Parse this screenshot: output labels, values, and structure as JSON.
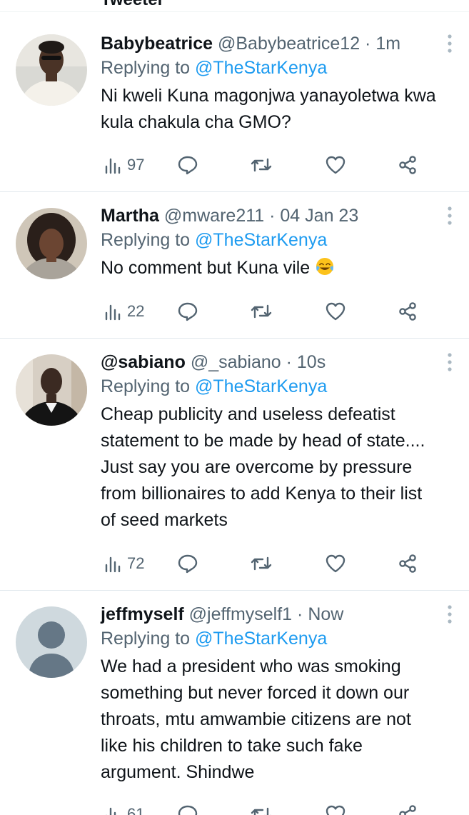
{
  "top_fragment": {
    "label": "Tweeter"
  },
  "tweets": [
    {
      "name": "Babybeatrice",
      "handle": "@Babybeatrice12",
      "separator": "·",
      "time": "1m",
      "replying_prefix": "Replying to",
      "replying_to": "@TheStarKenya",
      "text": "Ni kweli Kuna magonjwa yanayoletwa kwa kula chakula cha GMO?",
      "emoji": "",
      "views": "97"
    },
    {
      "name": "Martha",
      "handle": "@mware211",
      "separator": "·",
      "time": "04 Jan 23",
      "replying_prefix": "Replying to",
      "replying_to": "@TheStarKenya",
      "text": "No comment but Kuna vile",
      "emoji": "face-with-tears-of-joy",
      "views": "22"
    },
    {
      "name": "@sabiano",
      "handle": "@_sabiano",
      "separator": "·",
      "time": "10s",
      "replying_prefix": "Replying to",
      "replying_to": "@TheStarKenya",
      "text": "Cheap publicity and useless defeatist statement to be made by head of state.... Just say you are overcome by pressure from billionaires to add Kenya to their list of seed markets",
      "emoji": "",
      "views": "72"
    },
    {
      "name": "jeffmyself",
      "handle": "@jeffmyself1",
      "separator": "·",
      "time": "Now",
      "replying_prefix": "Replying to",
      "replying_to": "@TheStarKenya",
      "text": "We had a president who was smoking something but never forced it down our throats, mtu amwambie citizens are not like his children to take such fake argument. Shindwe",
      "emoji": "",
      "views": "61"
    }
  ],
  "icons": {
    "views": "bar-chart-icon",
    "reply": "speech-bubble-icon",
    "retweet": "retweet-arrows-icon",
    "like": "heart-icon",
    "share": "share-nodes-icon",
    "more": "vertical-dots-icon"
  },
  "colors": {
    "text": "#0f1419",
    "secondary": "#536471",
    "link": "#1d9bf0",
    "divider": "#e1e8ed"
  }
}
